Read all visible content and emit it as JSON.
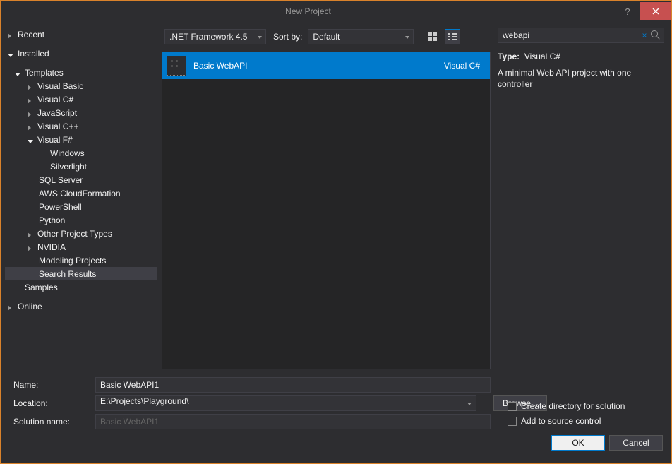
{
  "window": {
    "title": "New Project"
  },
  "sidebar": {
    "recent": "Recent",
    "installed": "Installed",
    "templates": "Templates",
    "items": [
      {
        "label": "Visual Basic"
      },
      {
        "label": "Visual C#"
      },
      {
        "label": "JavaScript"
      },
      {
        "label": "Visual C++"
      },
      {
        "label": "Visual F#"
      },
      {
        "label": "Windows"
      },
      {
        "label": "Silverlight"
      },
      {
        "label": "SQL Server"
      },
      {
        "label": "AWS CloudFormation"
      },
      {
        "label": "PowerShell"
      },
      {
        "label": "Python"
      },
      {
        "label": "Other Project Types"
      },
      {
        "label": "NVIDIA"
      },
      {
        "label": "Modeling Projects"
      },
      {
        "label": "Search Results"
      }
    ],
    "samples": "Samples",
    "online": "Online"
  },
  "toolbar": {
    "framework": ".NET Framework 4.5",
    "sort_label": "Sort by:",
    "sort_value": "Default"
  },
  "templates": [
    {
      "name": "Basic WebAPI",
      "lang": "Visual C#"
    }
  ],
  "search": {
    "value": "webapi"
  },
  "details": {
    "type_label": "Type:",
    "type_value": "Visual C#",
    "description": "A minimal Web API project with one controller"
  },
  "form": {
    "name_label": "Name:",
    "name_value": "Basic WebAPI1",
    "location_label": "Location:",
    "location_value": "E:\\Projects\\Playground\\",
    "solution_label": "Solution name:",
    "solution_value": "Basic WebAPI1",
    "browse": "Browse...",
    "create_dir": "Create directory for solution",
    "source_control": "Add to source control"
  },
  "buttons": {
    "ok": "OK",
    "cancel": "Cancel"
  }
}
